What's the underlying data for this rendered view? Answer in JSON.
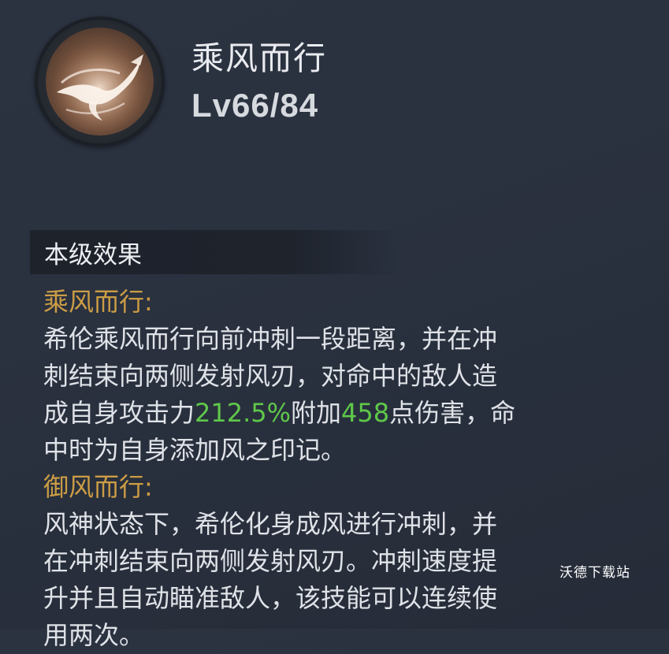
{
  "skill": {
    "name": "乘风而行",
    "level": "Lv66/84",
    "icon": "wind-rider-skill-icon"
  },
  "section": {
    "title": "本级效果"
  },
  "effects": [
    {
      "heading": "乘风而行:",
      "lines": [
        {
          "segments": [
            {
              "text": "希伦乘风而行向前冲刺一段距离，并在冲"
            }
          ]
        },
        {
          "segments": [
            {
              "text": "刺结束向两侧发射风刃，对命中的敌人造"
            }
          ]
        },
        {
          "segments": [
            {
              "text": "成自身攻击力"
            },
            {
              "text": "212.5%",
              "highlight": true
            },
            {
              "text": "附加"
            },
            {
              "text": "458",
              "highlight": true
            },
            {
              "text": "点伤害，命"
            }
          ]
        },
        {
          "segments": [
            {
              "text": "中时为自身添加风之印记。"
            }
          ]
        }
      ]
    },
    {
      "heading": "御风而行:",
      "lines": [
        {
          "segments": [
            {
              "text": "风神状态下，希伦化身成风进行冲刺，并"
            }
          ]
        },
        {
          "segments": [
            {
              "text": "在冲刺结束向两侧发射风刃。冲刺速度提"
            }
          ]
        },
        {
          "segments": [
            {
              "text": "升并且自动瞄准敌人，该技能可以连续使"
            }
          ]
        },
        {
          "segments": [
            {
              "text": "用两次。"
            }
          ]
        }
      ]
    }
  ],
  "watermark": "沃德下载站",
  "colors": {
    "heading_gold": "#cc9d45",
    "value_green": "#5fc84a",
    "background": "#2a313f"
  }
}
